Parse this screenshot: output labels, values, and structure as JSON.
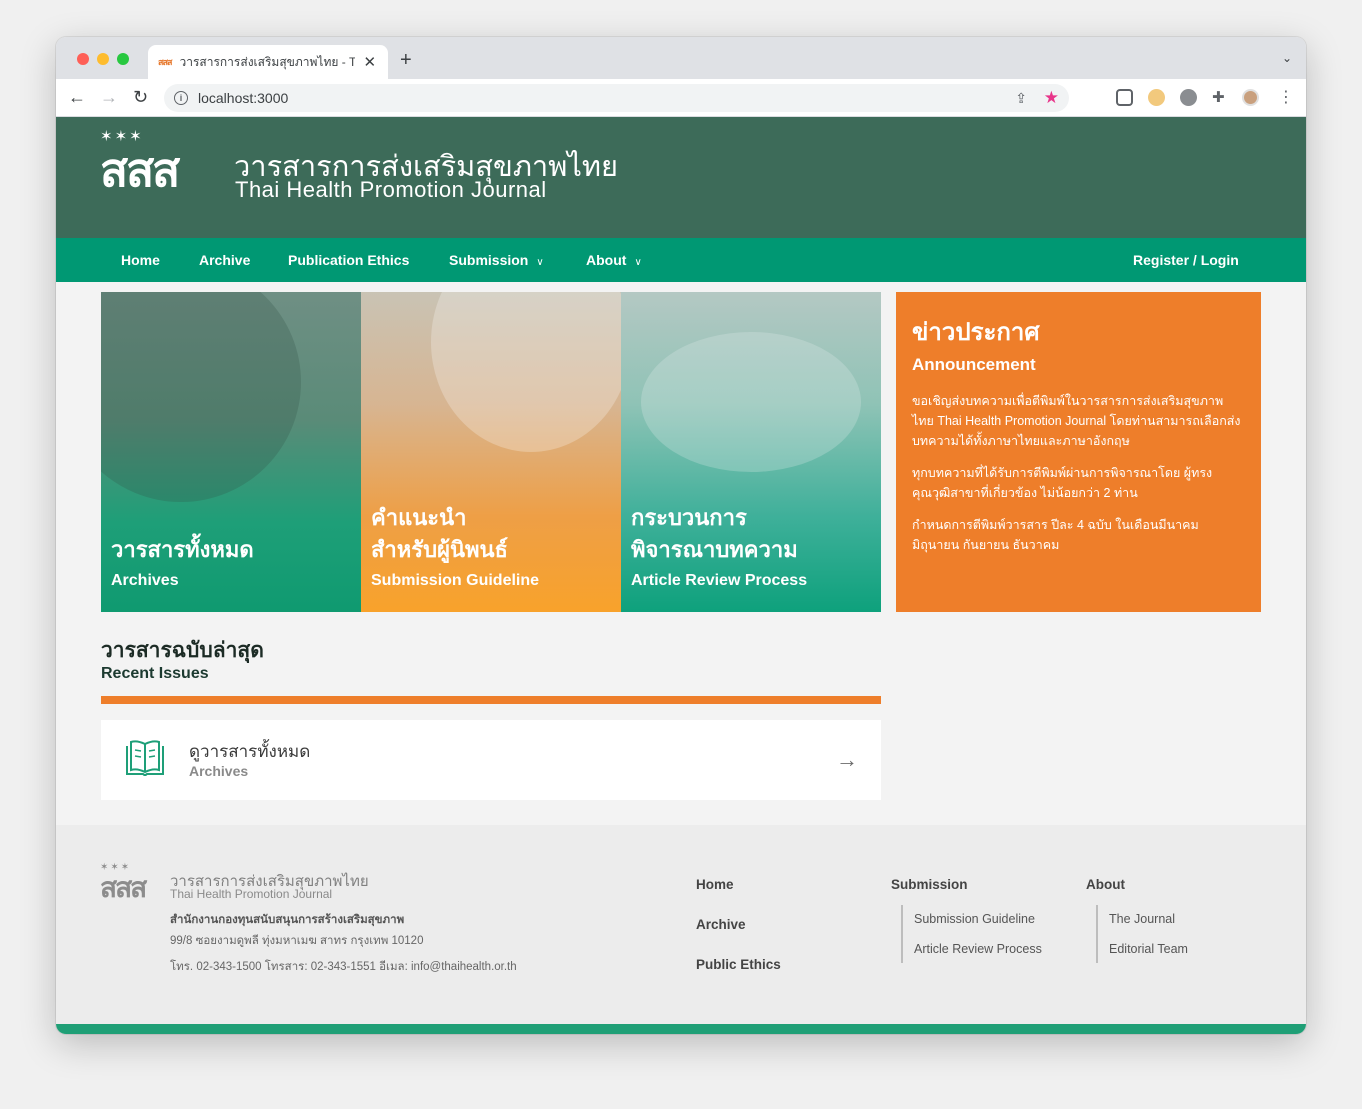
{
  "browser": {
    "tab_title": "วารสารการส่งเสริมสุขภาพไทย - Th",
    "tab_favicon": "สสส",
    "url": "localhost:3000",
    "new_tab": "+",
    "close": "✕"
  },
  "header": {
    "logo_mark": "สสส",
    "logo_stars": "✶✶✶",
    "title_th": "วารสารการส่งเสริมสุขภาพไทย",
    "title_en": "Thai Health Promotion Journal"
  },
  "nav": {
    "home": "Home",
    "archive": "Archive",
    "ethics": "Publication Ethics",
    "submission": "Submission",
    "about": "About",
    "register": "Register / Login"
  },
  "cards": [
    {
      "th_line1": "วารสารทั้งหมด",
      "th_line2": "",
      "en": "Archives"
    },
    {
      "th_line1": "คำแนะนำ",
      "th_line2": "สำหรับผู้นิพนธ์",
      "en": "Submission Guideline"
    },
    {
      "th_line1": "กระบวนการ",
      "th_line2": "พิจารณาบทความ",
      "en": "Article Review Process"
    }
  ],
  "announcement": {
    "title_th": "ข่าวประกาศ",
    "title_en": "Announcement",
    "p1": "ขอเชิญส่งบทความเพื่อตีพิมพ์ในวารสารการส่งเสริมสุขภาพไทย Thai Health Promotion Journal โดยท่านสามารถเลือกส่งบทความได้ทั้งภาษาไทยและภาษาอังกฤษ",
    "p2": "ทุกบทความที่ได้รับการตีพิมพ์ผ่านการพิจารณาโดย ผู้ทรงคุณวุฒิสาขาที่เกี่ยวข้อง ไม่น้อยกว่า 2 ท่าน",
    "p3": "กำหนดการตีพิมพ์วารสาร ปีละ 4 ฉบับ ในเดือนมีนาคม มิถุนายน กันยายน ธันวาคม"
  },
  "recent": {
    "title_th": "วารสารฉบับล่าสุด",
    "title_en": "Recent Issues",
    "archive_th": "ดูวารสารทั้งหมด",
    "archive_en": "Archives"
  },
  "footer": {
    "title_th": "วารสารการส่งเสริมสุขภาพไทย",
    "title_en": "Thai Health Promotion Journal",
    "org": "สำนักงานกองทุนสนับสนุนการสร้างเสริมสุขภาพ",
    "address": "99/8 ซอยงามดูพลี ทุ่งมหาเมฆ สาทร กรุงเทพ 10120",
    "contact": "โทร. 02-343-1500 โทรสาร: 02-343-1551 อีเมล: info@thaihealth.or.th",
    "links": {
      "home": "Home",
      "archive": "Archive",
      "ethics": "Public Ethics"
    },
    "submission_head": "Submission",
    "submission_items": [
      "Submission Guideline",
      "Article Review Process"
    ],
    "about_head": "About",
    "about_items": [
      "The Journal",
      "Editorial Team"
    ]
  }
}
